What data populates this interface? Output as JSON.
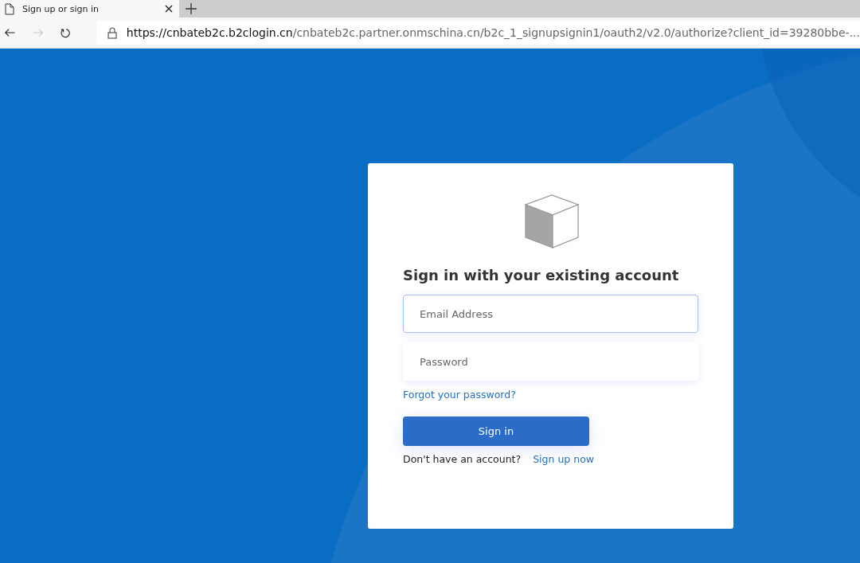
{
  "browser": {
    "tab": {
      "title": "Sign up or sign in",
      "selected": true
    },
    "url": {
      "host": "https://cnbateb2c.b2clogin.cn",
      "path": "/cnbateb2c.partner.onmschina.cn/b2c_1_signupsignin1/oauth2/v2.0/authorize?client_id=39280bbe-..."
    },
    "forward_disabled": true
  },
  "card": {
    "heading": "Sign in with your existing account",
    "fields": [
      {
        "placeholder": "Email Address",
        "focused": true
      },
      {
        "placeholder": "Password",
        "focused": false
      }
    ],
    "forgot_link": "Forgot your password?",
    "submit": "Sign in",
    "signup_prompt": "Don't have an account?",
    "signup_link": "Sign up now"
  }
}
